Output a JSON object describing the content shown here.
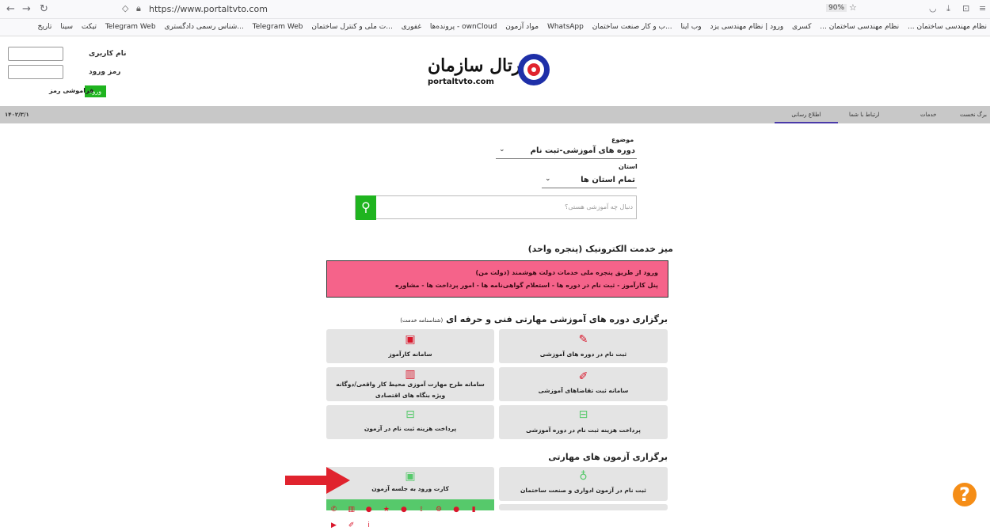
{
  "browser": {
    "url": "https://www.portaltvto.com",
    "zoom": "90%",
    "bookmarks": [
      "نظام مهندسی ساختمان ...",
      "نظام مهندسی ساختمان ...",
      "کسری",
      "ورود | نظام مهندسی یزد",
      "وب اینا",
      "...ب و کار صنعت ساختمان",
      "WhatsApp",
      "مواد آزمون",
      "ownCloud - پرونده‌ها",
      "غفوری",
      "...ت ملی و کنترل ساختمان",
      "Telegram Web",
      "...شناس رسمی دادگستری",
      "Telegram Web",
      "تیکت",
      "سینا",
      "تاریخ"
    ]
  },
  "login": {
    "username_label": "نام کاربری",
    "password_label": "رمز ورود",
    "login_button": "ورود",
    "forgot_password": "فراموشی رمز"
  },
  "logo": {
    "title": "پورتال سازمان",
    "domain": "portaltvto.com"
  },
  "navbar": {
    "date": "۱۴۰۲/۳/۱",
    "items": [
      "برگ نخست",
      "خدمات",
      "ارتباط با شما",
      "اطلاع رسانی"
    ]
  },
  "form": {
    "topic_label": "موضوع",
    "topic_value": "دوره های آموزشی-ثبت نام",
    "province_label": "استان",
    "province_value": "تمام استان ها",
    "search_placeholder": "دنبال چه آموزشی هستی؟"
  },
  "egov": {
    "title": "میز خدمت الکترونیک (پنجره واحد)",
    "line1": "ورود از طریق پنجره ملی خدمات دولت هوشمند (دولت من)",
    "line2": "پنل کارآموز - ثبت نام در دوره ها - استعلام گواهی‌نامه ها - امور پرداخت ها - مشاوره"
  },
  "courses": {
    "title": "برگزاری دوره های آموزشی مهارتی فنی و حرفه ای",
    "title_suffix": "(شناسنامه خدمت)",
    "cards": [
      {
        "label": "ثبت نام در دوره های آموزشی",
        "icon": "edit-icon"
      },
      {
        "label": "سامانه کارآموز",
        "icon": "id-card-icon"
      },
      {
        "label": "سامانه ثبت تقاضاهای آموزشی",
        "icon": "edit-outline-icon"
      },
      {
        "label_line1": "سامانه طرح مهارت آموزی محیط کار واقعی/دوگانه",
        "label_line2": "ویژه بنگاه های اقتصادی",
        "icon": "building-icon"
      },
      {
        "label": "پرداخت هزینه ثبت نام در دوره آموزشی",
        "icon": "money-icon"
      },
      {
        "label": "پرداخت هزینه ثبت نام در آزمون",
        "icon": "money-icon"
      }
    ]
  },
  "exams": {
    "title": "برگزاری آزمون های مهارتی",
    "cards": [
      {
        "label": "ثبت نام در آزمون ادواری و صنعت ساختمان",
        "icon": "award-icon"
      },
      {
        "label": "کارت ورود به جلسه آزمون",
        "icon": "id-card-icon"
      }
    ]
  },
  "colors": {
    "green": "#1fb41f",
    "pink": "#f5638a",
    "card_bg": "#e4e4e4",
    "navbar": "#c8c8c8",
    "accent_red": "#d9162b",
    "help_orange": "#f58d16"
  }
}
